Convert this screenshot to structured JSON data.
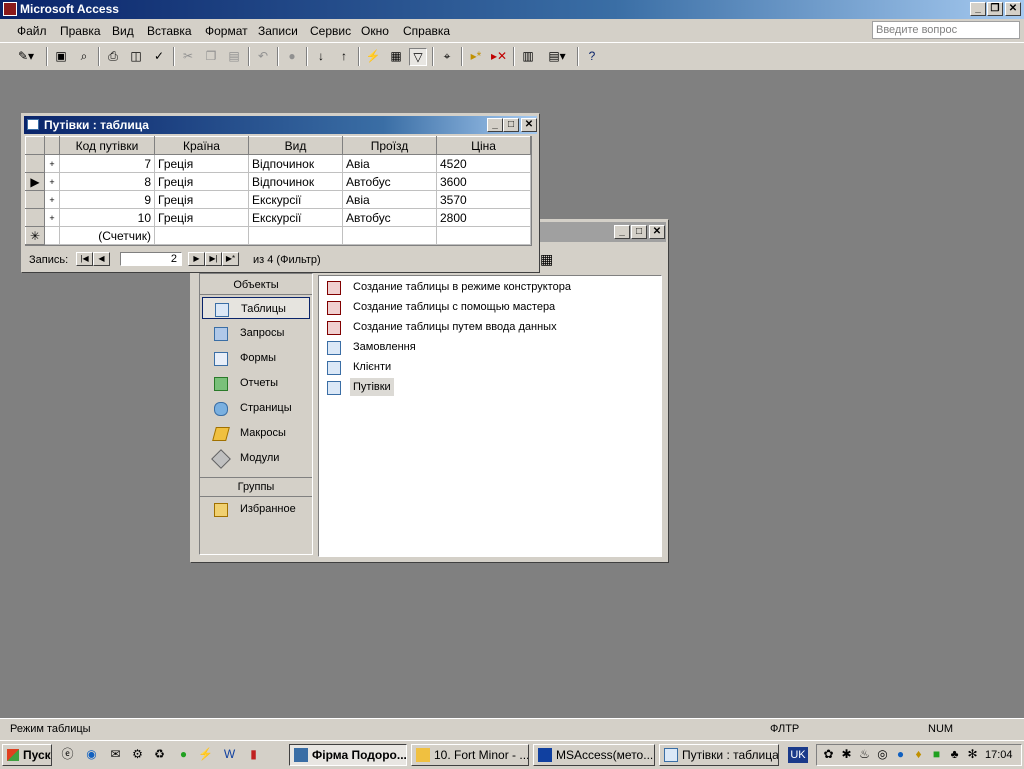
{
  "app": {
    "title": "Microsoft Access",
    "caption_buttons": [
      "_",
      "❐",
      "✕"
    ]
  },
  "menu": {
    "items": [
      "Файл",
      "Правка",
      "Вид",
      "Вставка",
      "Формат",
      "Записи",
      "Сервис",
      "Окно",
      "Справка"
    ],
    "ask_placeholder": "Введите вопрос"
  },
  "table_window": {
    "title": "Путівки : таблица",
    "columns": [
      "Код путівки",
      "Країна",
      "Вид",
      "Проїзд",
      "Ціна"
    ],
    "rows": [
      {
        "code": "7",
        "country": "Греція",
        "type": "Відпочинок",
        "transport": "Авіа",
        "price": "4520"
      },
      {
        "code": "8",
        "country": "Греція",
        "type": "Відпочинок",
        "transport": "Автобус",
        "price": "3600"
      },
      {
        "code": "9",
        "country": "Греція",
        "type": "Екскурсії",
        "transport": "Авіа",
        "price": "3570"
      },
      {
        "code": "10",
        "country": "Греція",
        "type": "Екскурсії",
        "transport": "Автобус",
        "price": "2800"
      }
    ],
    "new_row_code": "(Счетчик)",
    "current_row": 1,
    "nav": {
      "label": "Запись:",
      "current": "2",
      "of_text": "из 4 (Фильтр)"
    }
  },
  "db_window": {
    "objects_header": "Объекты",
    "objects": [
      {
        "label": "Таблицы",
        "icon": "table-icon",
        "selected": true
      },
      {
        "label": "Запросы",
        "icon": "query-icon"
      },
      {
        "label": "Формы",
        "icon": "form-icon"
      },
      {
        "label": "Отчеты",
        "icon": "report-icon"
      },
      {
        "label": "Страницы",
        "icon": "page-icon"
      },
      {
        "label": "Макросы",
        "icon": "macro-icon"
      },
      {
        "label": "Модули",
        "icon": "module-icon"
      }
    ],
    "groups_header": "Группы",
    "groups": [
      {
        "label": "Избранное",
        "icon": "favorites-icon"
      }
    ],
    "list": [
      {
        "label": "Создание таблицы в режиме конструктора",
        "icon": "wizard-icon"
      },
      {
        "label": "Создание таблицы с помощью мастера",
        "icon": "wizard-icon"
      },
      {
        "label": "Создание таблицы путем ввода данных",
        "icon": "wizard-icon"
      },
      {
        "label": "Замовлення",
        "icon": "table-icon"
      },
      {
        "label": "Клієнти",
        "icon": "table-icon"
      },
      {
        "label": "Путівки",
        "icon": "table-icon",
        "selected": true
      }
    ]
  },
  "status": {
    "mode": "Режим таблицы",
    "filter": "ФЛТР",
    "num": "NUM"
  },
  "taskbar": {
    "start": "Пуск",
    "tasks": [
      {
        "label": "Фірма Подоро...",
        "active": true
      },
      {
        "label": "10. Fort Minor - ..."
      },
      {
        "label": "MSAccess(мето..."
      },
      {
        "label": "Путівки : таблица"
      }
    ],
    "lang": "UK",
    "clock": "17:04"
  }
}
